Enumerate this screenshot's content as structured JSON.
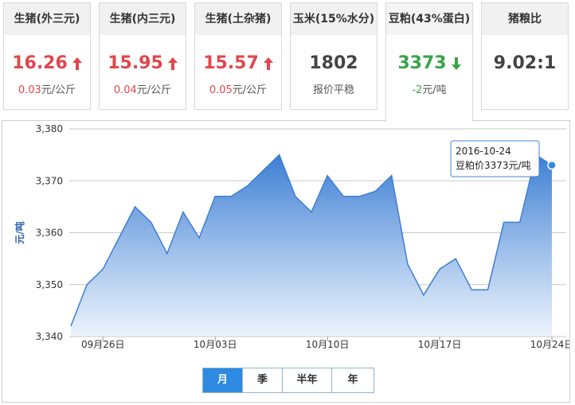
{
  "cards": [
    {
      "title": "生猪(外三元)",
      "value": "16.26",
      "trend": "up",
      "change": "0.03",
      "unit": "元/公斤"
    },
    {
      "title": "生猪(内三元)",
      "value": "15.95",
      "trend": "up",
      "change": "0.04",
      "unit": "元/公斤"
    },
    {
      "title": "生猪(土杂猪)",
      "value": "15.57",
      "trend": "up",
      "change": "0.05",
      "unit": "元/公斤"
    },
    {
      "title": "玉米(15%水分)",
      "value": "1802",
      "trend": "flat",
      "change": "",
      "unit": "报价平稳"
    },
    {
      "title": "豆粕(43%蛋白)",
      "value": "3373",
      "trend": "down",
      "change": "-2",
      "unit": "元/吨"
    },
    {
      "title": "猪粮比",
      "value": "9.02:1",
      "trend": "flat",
      "change": "",
      "unit": ""
    }
  ],
  "tabs": [
    "月",
    "季",
    "半年",
    "年"
  ],
  "active_tab": 0,
  "tooltip": {
    "date": "2016-10-24",
    "label": "豆粕价3373元/吨"
  },
  "colors": {
    "up": "#e0474c",
    "down": "#3aa34a",
    "line": "#3f7fd0",
    "active_tab": "#2d8ae0"
  },
  "chart_data": {
    "type": "area",
    "ylabel": "元/吨",
    "ylim": [
      3340,
      3380
    ],
    "yticks": [
      "3,340",
      "3,350",
      "3,360",
      "3,370",
      "3,380"
    ],
    "ytick_values": [
      3340,
      3350,
      3360,
      3370,
      3380
    ],
    "xticks": [
      "09月26日",
      "10月03日",
      "10月10日",
      "10月17日",
      "10月24日"
    ],
    "xtick_dates": [
      "2016-09-26",
      "2016-10-03",
      "2016-10-10",
      "2016-10-17",
      "2016-10-24"
    ],
    "grid": true,
    "series": [
      {
        "x": [
          "2016-09-24",
          "2016-09-25",
          "2016-09-26",
          "2016-09-27",
          "2016-09-28",
          "2016-09-29",
          "2016-09-30",
          "2016-10-01",
          "2016-10-02",
          "2016-10-03",
          "2016-10-04",
          "2016-10-05",
          "2016-10-06",
          "2016-10-07",
          "2016-10-08",
          "2016-10-09",
          "2016-10-10",
          "2016-10-11",
          "2016-10-12",
          "2016-10-13",
          "2016-10-14",
          "2016-10-15",
          "2016-10-16",
          "2016-10-17",
          "2016-10-18",
          "2016-10-19",
          "2016-10-20",
          "2016-10-21",
          "2016-10-22",
          "2016-10-23",
          "2016-10-24"
        ],
        "values": [
          3342,
          3350,
          3353,
          3359,
          3365,
          3362,
          3356,
          3364,
          3359,
          3367,
          3367,
          3369,
          3372,
          3375,
          3367,
          3364,
          3371,
          3367,
          3367,
          3368,
          3371,
          3354,
          3348,
          3353,
          3355,
          3349,
          3349,
          3362,
          3362,
          3375,
          3373
        ]
      }
    ]
  }
}
